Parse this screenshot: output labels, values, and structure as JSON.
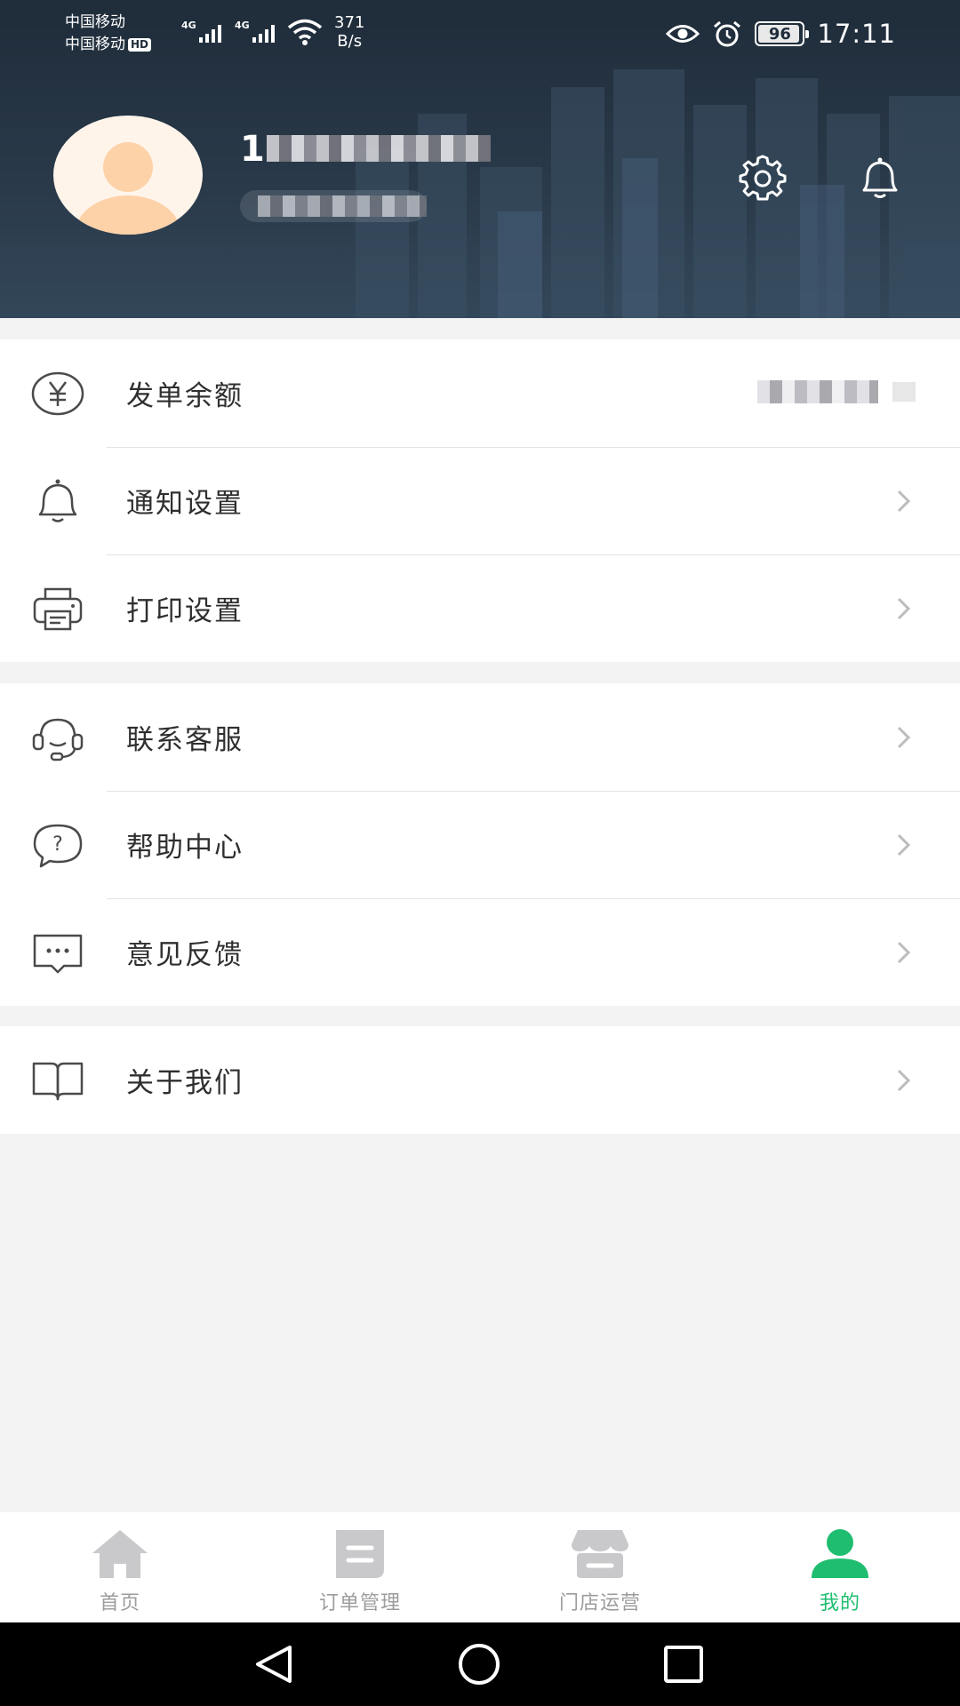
{
  "status_bar": {
    "carrier_1": "中国移动",
    "carrier_2": "中国移动",
    "hd_badge": "HD",
    "signal_1_tag": "4G",
    "signal_2_tag": "4G",
    "net_speed_value": "371",
    "net_speed_unit": "B/s",
    "battery_level": "96",
    "time": "17:11",
    "icons": [
      "eye-icon",
      "alarm-icon",
      "battery-icon",
      "wifi-icon",
      "signal-icon"
    ]
  },
  "profile": {
    "phone_visible_prefix": "1",
    "phone_redacted": true,
    "subtitle_redacted": true,
    "icons": [
      "avatar-icon",
      "gear-icon",
      "bell-icon"
    ]
  },
  "menu": {
    "sections": [
      {
        "items": [
          {
            "label": "发单余额",
            "icon": "yuan-icon",
            "value_redacted": true
          },
          {
            "label": "通知设置",
            "icon": "bell-icon"
          },
          {
            "label": "打印设置",
            "icon": "printer-icon"
          }
        ]
      },
      {
        "items": [
          {
            "label": "联系客服",
            "icon": "headset-icon"
          },
          {
            "label": "帮助中心",
            "icon": "help-bubble-icon"
          },
          {
            "label": "意见反馈",
            "icon": "message-icon"
          }
        ]
      },
      {
        "items": [
          {
            "label": "关于我们",
            "icon": "book-icon"
          }
        ]
      }
    ]
  },
  "tabbar": {
    "tabs": [
      {
        "label": "首页",
        "icon": "home-icon",
        "active": false
      },
      {
        "label": "订单管理",
        "icon": "order-icon",
        "active": false
      },
      {
        "label": "门店运营",
        "icon": "store-icon",
        "active": false
      },
      {
        "label": "我的",
        "icon": "user-icon",
        "active": true
      }
    ],
    "active_color": "#1fbd6f",
    "inactive_color": "#9c9c9c"
  },
  "navbar": {
    "icons": [
      "back-triangle-icon",
      "home-circle-icon",
      "recents-square-icon"
    ]
  }
}
